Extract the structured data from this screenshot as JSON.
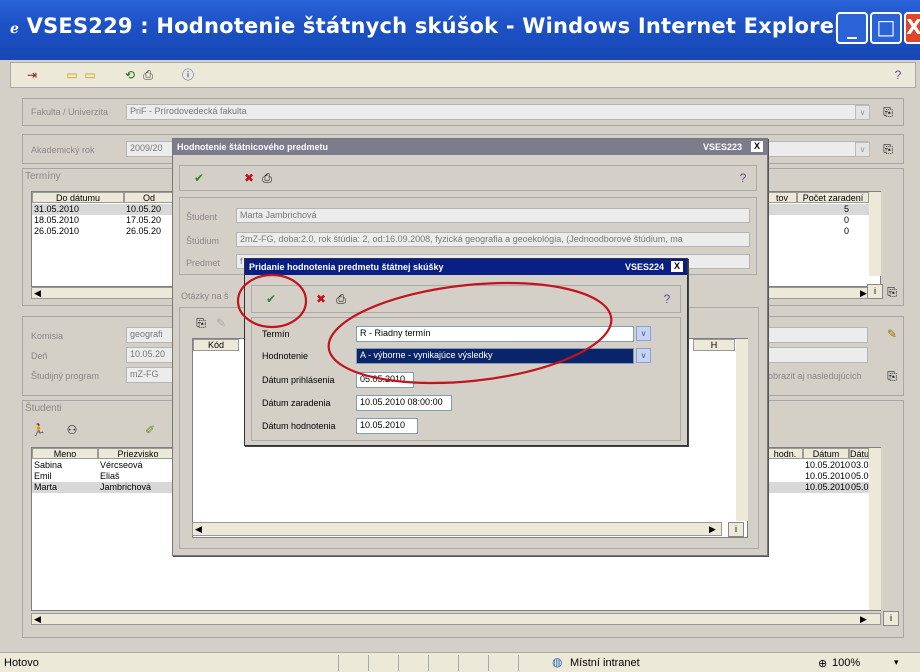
{
  "window": {
    "title": "VSES229 : Hodnotenie štátnych skúšok - Windows Internet Explorer",
    "min": "_",
    "max": "□",
    "close": "X"
  },
  "toolbar": {
    "help_icon": "question-icon"
  },
  "faculty": {
    "label": "Fakulta / Univerzita",
    "value": "PriF - Prírodovedecká fakulta"
  },
  "year": {
    "label": "Akademický rok",
    "value": "2009/20"
  },
  "terms": {
    "section": "Termíny",
    "columns": [
      "Do dátumu",
      "Od",
      "tov",
      "Počet zaradení"
    ],
    "rows": [
      {
        "do": "31.05.2010",
        "od": "10.05.20",
        "count": "5"
      },
      {
        "do": "18.05.2010",
        "od": "17.05.20",
        "count": "0"
      },
      {
        "do": "26.05.2010",
        "od": "26.05.20",
        "count": "0"
      }
    ]
  },
  "commission": {
    "label": "Komisia",
    "value": "geografi",
    "day_label": "Deň",
    "day_value": "10.05.20",
    "program_label": "Študijný program",
    "program_value": "mZ-FG",
    "show_next": "obrazit aj nasledujúcich"
  },
  "students": {
    "section": "Študenti",
    "columns": [
      "Meno",
      "Priezvisko",
      "hodn.",
      "Dátum",
      "Dátu"
    ],
    "rows": [
      {
        "first": "Sabina",
        "last": "Vércseová",
        "date": "10.05.2010",
        "date2": "03.05."
      },
      {
        "first": "Emil",
        "last": "Eliaš",
        "date": "10.05.2010",
        "date2": "05.05."
      },
      {
        "first": "Marta",
        "last": "Jambrichová",
        "date": "10.05.2010",
        "date2": "05.05."
      }
    ]
  },
  "dlg1": {
    "title": "Hodnotenie štátnicového predmetu",
    "code": "VSES223",
    "close": "X",
    "student_label": "Študent",
    "student_value": "Marta Jambrichová",
    "study_label": "Štúdium",
    "study_value": "2mZ-FG, doba:2.0, rok štúdia: 2, od:16.09.2008, fyzická geografia a geoekológia, (Jednoodborové štúdium, ma",
    "subject_label": "Predmet",
    "subject_value": "f",
    "questions_tab": "Otázky na š",
    "kod_col": "Kód",
    "h_col": "H"
  },
  "dlg2": {
    "title": "Pridanie hodnotenia predmetu štátnej skúšky",
    "code": "VSES224",
    "close": "X",
    "term_label": "Termín",
    "term_value": "R - Riadny termín",
    "grade_label": "Hodnotenie",
    "grade_value": "A - výborne - vynikajúce výsledky",
    "reg_label": "Dátum prihlásenia",
    "reg_value": "05.05.2010",
    "assign_label": "Dátum zaradenia",
    "assign_value": "10.05.2010 08:00:00",
    "eval_label": "Dátum hodnotenia",
    "eval_value": "10.05.2010"
  },
  "status": {
    "left": "Hotovo",
    "zone": "Místní intranet",
    "zoom": "100%"
  },
  "colors": {
    "title": "#1d52c6",
    "dialog_title": "#0a1f85",
    "annotation": "#c0141e",
    "selection": "#0a246a"
  }
}
